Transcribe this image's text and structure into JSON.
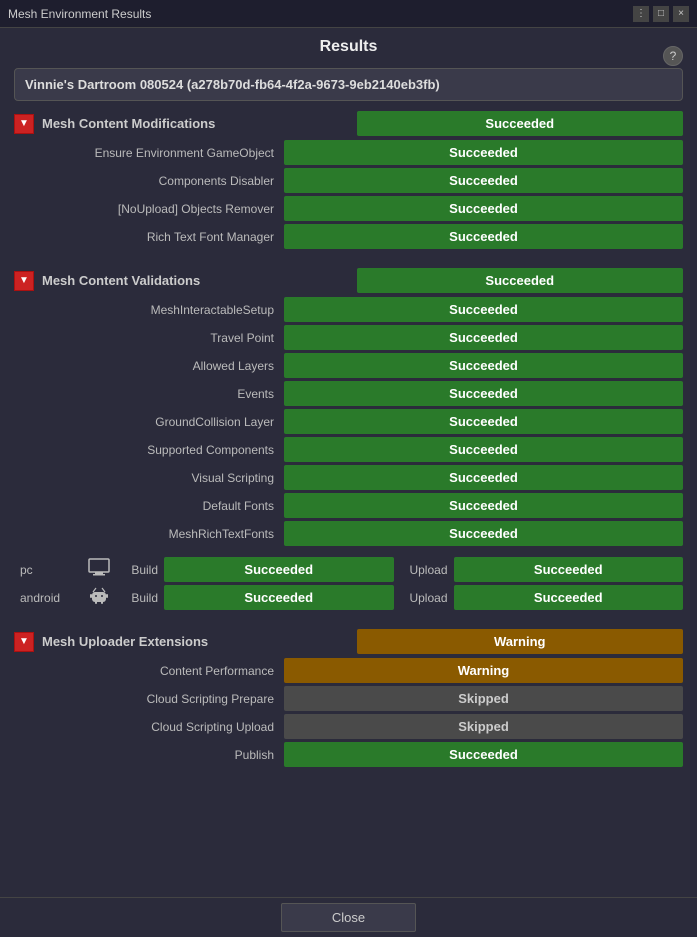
{
  "titleBar": {
    "title": "Mesh Environment Results",
    "controls": [
      "⋮",
      "□",
      "×"
    ]
  },
  "pageTitle": "Results",
  "helpIcon": "?",
  "environmentBox": {
    "title": "Vinnie's Dartroom 080524 (a278b70d-fb64-4f2a-9673-9eb2140eb3fb)"
  },
  "sections": [
    {
      "id": "mesh-content-modifications",
      "label": "Mesh Content Modifications",
      "status": "Succeeded",
      "statusClass": "status-succeeded",
      "rows": [
        {
          "label": "Ensure Environment GameObject",
          "status": "Succeeded",
          "statusClass": "status-succeeded"
        },
        {
          "label": "Components Disabler",
          "status": "Succeeded",
          "statusClass": "status-succeeded"
        },
        {
          "label": "[NoUpload] Objects Remover",
          "status": "Succeeded",
          "statusClass": "status-succeeded"
        },
        {
          "label": "Rich Text Font Manager",
          "status": "Succeeded",
          "statusClass": "status-succeeded"
        }
      ]
    },
    {
      "id": "mesh-content-validations",
      "label": "Mesh Content Validations",
      "status": "Succeeded",
      "statusClass": "status-succeeded",
      "rows": [
        {
          "label": "MeshInteractableSetup",
          "status": "Succeeded",
          "statusClass": "status-succeeded"
        },
        {
          "label": "Travel Point",
          "status": "Succeeded",
          "statusClass": "status-succeeded"
        },
        {
          "label": "Allowed Layers",
          "status": "Succeeded",
          "statusClass": "status-succeeded"
        },
        {
          "label": "Events",
          "status": "Succeeded",
          "statusClass": "status-succeeded"
        },
        {
          "label": "GroundCollision Layer",
          "status": "Succeeded",
          "statusClass": "status-succeeded"
        },
        {
          "label": "Supported Components",
          "status": "Succeeded",
          "statusClass": "status-succeeded"
        },
        {
          "label": "Visual Scripting",
          "status": "Succeeded",
          "statusClass": "status-succeeded"
        },
        {
          "label": "Default Fonts",
          "status": "Succeeded",
          "statusClass": "status-succeeded"
        },
        {
          "label": "MeshRichTextFonts",
          "status": "Succeeded",
          "statusClass": "status-succeeded"
        }
      ]
    }
  ],
  "platformRows": [
    {
      "name": "pc",
      "icon": "🖥",
      "buildLabel": "Build",
      "buildStatus": "Succeeded",
      "buildStatusClass": "status-succeeded",
      "uploadLabel": "Upload",
      "uploadStatus": "Succeeded",
      "uploadStatusClass": "status-succeeded"
    },
    {
      "name": "android",
      "icon": "📱",
      "buildLabel": "Build",
      "buildStatus": "Succeeded",
      "buildStatusClass": "status-succeeded",
      "uploadLabel": "Upload",
      "uploadStatus": "Succeeded",
      "uploadStatusClass": "status-succeeded"
    }
  ],
  "uploaderSection": {
    "label": "Mesh Uploader Extensions",
    "status": "Warning",
    "statusClass": "status-warning",
    "rows": [
      {
        "label": "Content Performance",
        "status": "Warning",
        "statusClass": "status-warning"
      },
      {
        "label": "Cloud Scripting Prepare",
        "status": "Skipped",
        "statusClass": "status-skipped"
      },
      {
        "label": "Cloud Scripting Upload",
        "status": "Skipped",
        "statusClass": "status-skipped"
      },
      {
        "label": "Publish",
        "status": "Succeeded",
        "statusClass": "status-succeeded"
      }
    ]
  },
  "footer": {
    "closeLabel": "Close"
  }
}
